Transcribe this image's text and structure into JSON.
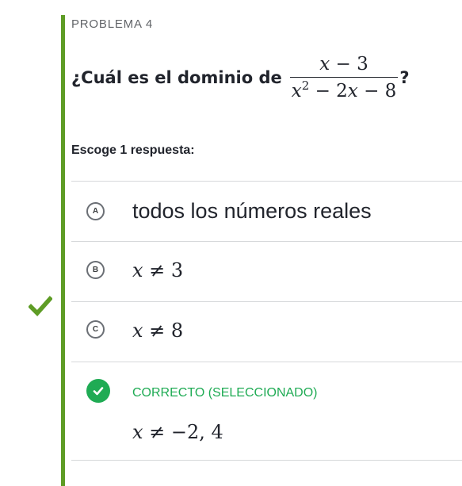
{
  "problem": {
    "label": "PROBLEMA 4",
    "question_text": "¿Cuál es el dominio de",
    "numerator_var": "x",
    "numerator_rest": " − 3",
    "denominator_var": "x",
    "denominator_exp": "2",
    "denominator_rest": " − 2",
    "denominator_var2": "x",
    "denominator_rest2": " − 8",
    "question_end": "?",
    "prompt": "Escoge 1 respuesta:"
  },
  "choices": [
    {
      "letter": "A",
      "text": "todos los números reales"
    },
    {
      "letter": "B",
      "var": "x",
      "rest": " ≠ 3"
    },
    {
      "letter": "C",
      "var": "x",
      "rest": " ≠ 8"
    },
    {
      "status": "CORRECTO (SELECCIONADO)",
      "var": "x",
      "rest": " ≠ −2, 4"
    }
  ],
  "colors": {
    "accent_bar": "#5e9c25",
    "side_check": "#5e9c25",
    "correct": "#1fab54",
    "text": "#21242c",
    "divider": "#d6d8da"
  },
  "icons": {
    "side_check": "checkmark-icon",
    "correct_badge": "check-circle-icon"
  }
}
